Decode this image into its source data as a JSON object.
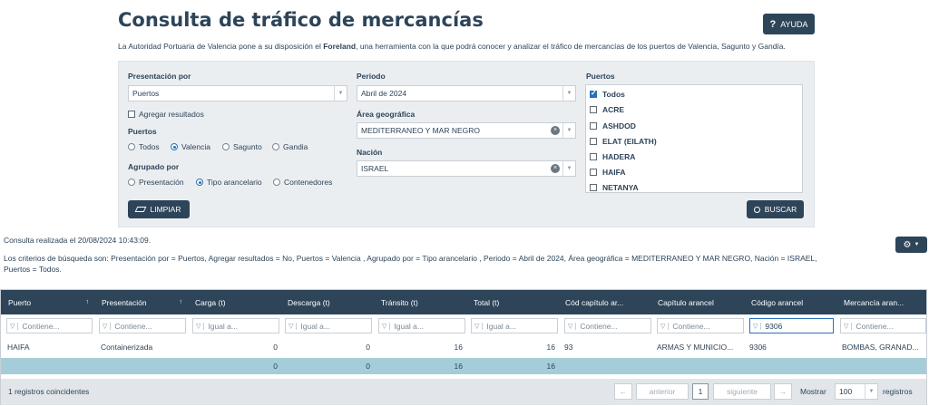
{
  "header": {
    "title": "Consulta de tráfico de mercancías",
    "help_label": "AYUDA",
    "intro_before": "La Autoridad Portuaria de Valencia pone a su disposición el ",
    "intro_bold": "Foreland",
    "intro_after": ", una herramienta con la que podrá conocer y analizar el tráfico de mercancías de los puertos de Valencia, Sagunto y Gandía."
  },
  "form": {
    "presentacion_label": "Presentación por",
    "presentacion_value": "Puertos",
    "agregar_label": "Agregar resultados",
    "agregar_checked": false,
    "puertos_label": "Puertos",
    "puertos_options": [
      "Todos",
      "Valencia",
      "Sagunto",
      "Gandia"
    ],
    "puertos_selected": "Valencia",
    "agrupado_label": "Agrupado por",
    "agrupado_options": [
      "Presentación",
      "Tipo arancelario",
      "Contenedores"
    ],
    "agrupado_selected": "Tipo arancelario",
    "periodo_label": "Periodo",
    "periodo_value": "Abril de 2024",
    "area_label": "Área geográfica",
    "area_value": "MEDITERRANEO Y MAR NEGRO",
    "nacion_label": "Nación",
    "nacion_value": "ISRAEL",
    "ports_list_label": "Puertos",
    "ports_list": [
      {
        "name": "Todos",
        "checked": true
      },
      {
        "name": "ACRE",
        "checked": false
      },
      {
        "name": "ASHDOD",
        "checked": false
      },
      {
        "name": "ELAT (EILATH)",
        "checked": false
      },
      {
        "name": "HADERA",
        "checked": false
      },
      {
        "name": "HAIFA",
        "checked": false
      },
      {
        "name": "NETANYA",
        "checked": false
      }
    ],
    "clear_label": "LIMPIAR",
    "search_label": "BUSCAR"
  },
  "info": {
    "timestamp": "Consulta realizada el 20/08/2024 10:43:09.",
    "criteria_line1": "Los criterios de búsqueda son: Presentación por = Puertos, Agregar resultados = No, Puertos = Valencia , Agrupado por = Tipo arancelario , Periodo = Abril de 2024, Área geográfica = MEDITERRANEO Y MAR NEGRO, Nación = ISRAEL,",
    "criteria_line2": "Puertos = Todos."
  },
  "grid": {
    "columns": [
      "Puerto",
      "Presentación",
      "Carga (t)",
      "Descarga (t)",
      "Tránsito (t)",
      "Total (t)",
      "Cód capítulo ar...",
      "Capítulo arancel",
      "Código arancel",
      "Mercancía aran..."
    ],
    "filters": [
      "Contiene...",
      "Contiene...",
      "Igual a...",
      "Igual a...",
      "Igual a...",
      "Igual a...",
      "Contiene...",
      "Contiene...",
      "9306",
      "Contiene..."
    ],
    "rows": [
      [
        "HAIFA",
        "Containerizada",
        "0",
        "0",
        "16",
        "16",
        "93",
        "ARMAS Y MUNICIO...",
        "9306",
        "BOMBAS, GRANAD..."
      ]
    ],
    "totals": [
      "0",
      "0",
      "16",
      "16"
    ],
    "footer": {
      "count": "1 registros coincidentes",
      "prev": "anterior",
      "page": "1",
      "next": "siguiente",
      "show_label": "Mostrar",
      "page_size": "100",
      "records_label": "registros"
    }
  },
  "colors": {
    "primary": "#2d4459",
    "panel": "#ebeef1",
    "total_row": "#a5cdd9",
    "accent": "#2a70b8"
  }
}
